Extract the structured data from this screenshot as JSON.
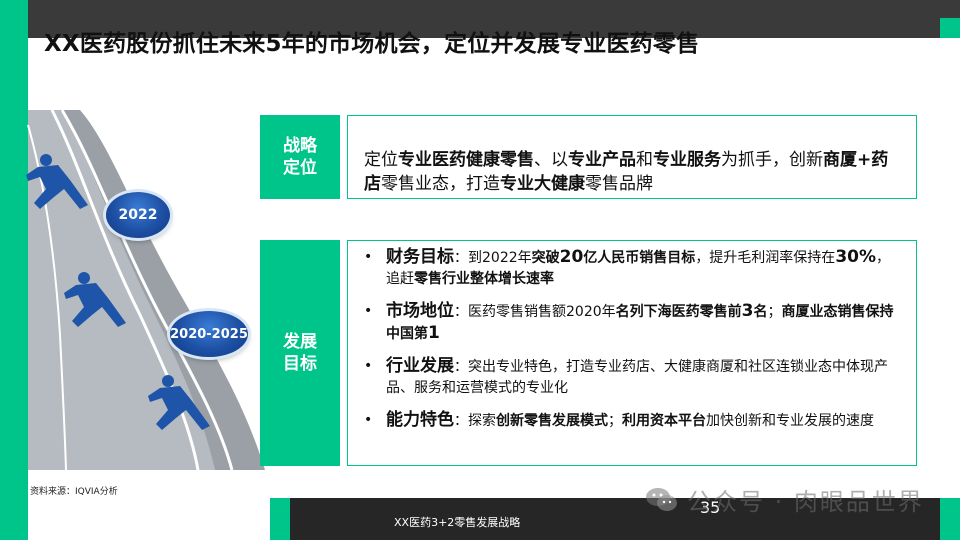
{
  "slide": {
    "title": "XX医药股份抓住未来5年的市场机会，定位并发展专业医药零售",
    "source_note": "资料来源：IQVIA分析",
    "footer_title": "XX医药3+2零售发展战略",
    "page_number": "35",
    "watermark": "公众号 · 肉眼品世界",
    "accent_color": "#00c58a",
    "badge_color": "#1d4fa3"
  },
  "timeline": {
    "badge_top": "2022",
    "badge_bottom": "2020-2025"
  },
  "strategy": {
    "label_line1": "战略",
    "label_line2": "定位",
    "text": [
      {
        "t": "定位",
        "bold": false
      },
      {
        "t": "专业医药健康零售",
        "bold": true
      },
      {
        "t": "、以",
        "bold": false
      },
      {
        "t": "专业产品",
        "bold": true
      },
      {
        "t": "和",
        "bold": false
      },
      {
        "t": "专业服务",
        "bold": true
      },
      {
        "t": "为抓手，创新",
        "bold": false
      },
      {
        "t": "商厦+药店",
        "bold": true
      },
      {
        "t": "零售业态，打造",
        "bold": false
      },
      {
        "t": "专业大健康",
        "bold": true
      },
      {
        "t": "零售品牌",
        "bold": false
      }
    ]
  },
  "development": {
    "label_line1": "发展",
    "label_line2": "目标",
    "bullets": [
      [
        {
          "t": "财务目标",
          "bold": true,
          "big": true
        },
        {
          "t": "：到2022年",
          "bold": false
        },
        {
          "t": "突破",
          "bold": true
        },
        {
          "t": "20",
          "bold": true,
          "big": true
        },
        {
          "t": "亿人民币销售目标",
          "bold": true
        },
        {
          "t": "，提升毛利润率保持在",
          "bold": false
        },
        {
          "t": "30%",
          "bold": true,
          "big": true
        },
        {
          "t": "，追赶",
          "bold": false
        },
        {
          "t": "零售行业整体增长速率",
          "bold": true
        }
      ],
      [
        {
          "t": "市场地位",
          "bold": true,
          "big": true
        },
        {
          "t": "：医药零售销售额2020年",
          "bold": false
        },
        {
          "t": "名列下海医药零售前",
          "bold": true
        },
        {
          "t": "3",
          "bold": true,
          "big": true
        },
        {
          "t": "名",
          "bold": true
        },
        {
          "t": "；",
          "bold": false
        },
        {
          "t": "商厦业态销售保持中国第",
          "bold": true
        },
        {
          "t": "1",
          "bold": true,
          "big": true
        }
      ],
      [
        {
          "t": "行业发展",
          "bold": true,
          "big": true
        },
        {
          "t": "：突出专业特色，打造专业药店、大健康商厦和社区连锁业态中体现产品、服务和运营模式的专业化",
          "bold": false
        }
      ],
      [
        {
          "t": "能力特色",
          "bold": true,
          "big": true
        },
        {
          "t": "：探索",
          "bold": false
        },
        {
          "t": "创新零售发展模式",
          "bold": true
        },
        {
          "t": "；",
          "bold": false
        },
        {
          "t": "利用资本平台",
          "bold": true
        },
        {
          "t": "加快创新和专业发展的速度",
          "bold": false
        }
      ]
    ]
  }
}
